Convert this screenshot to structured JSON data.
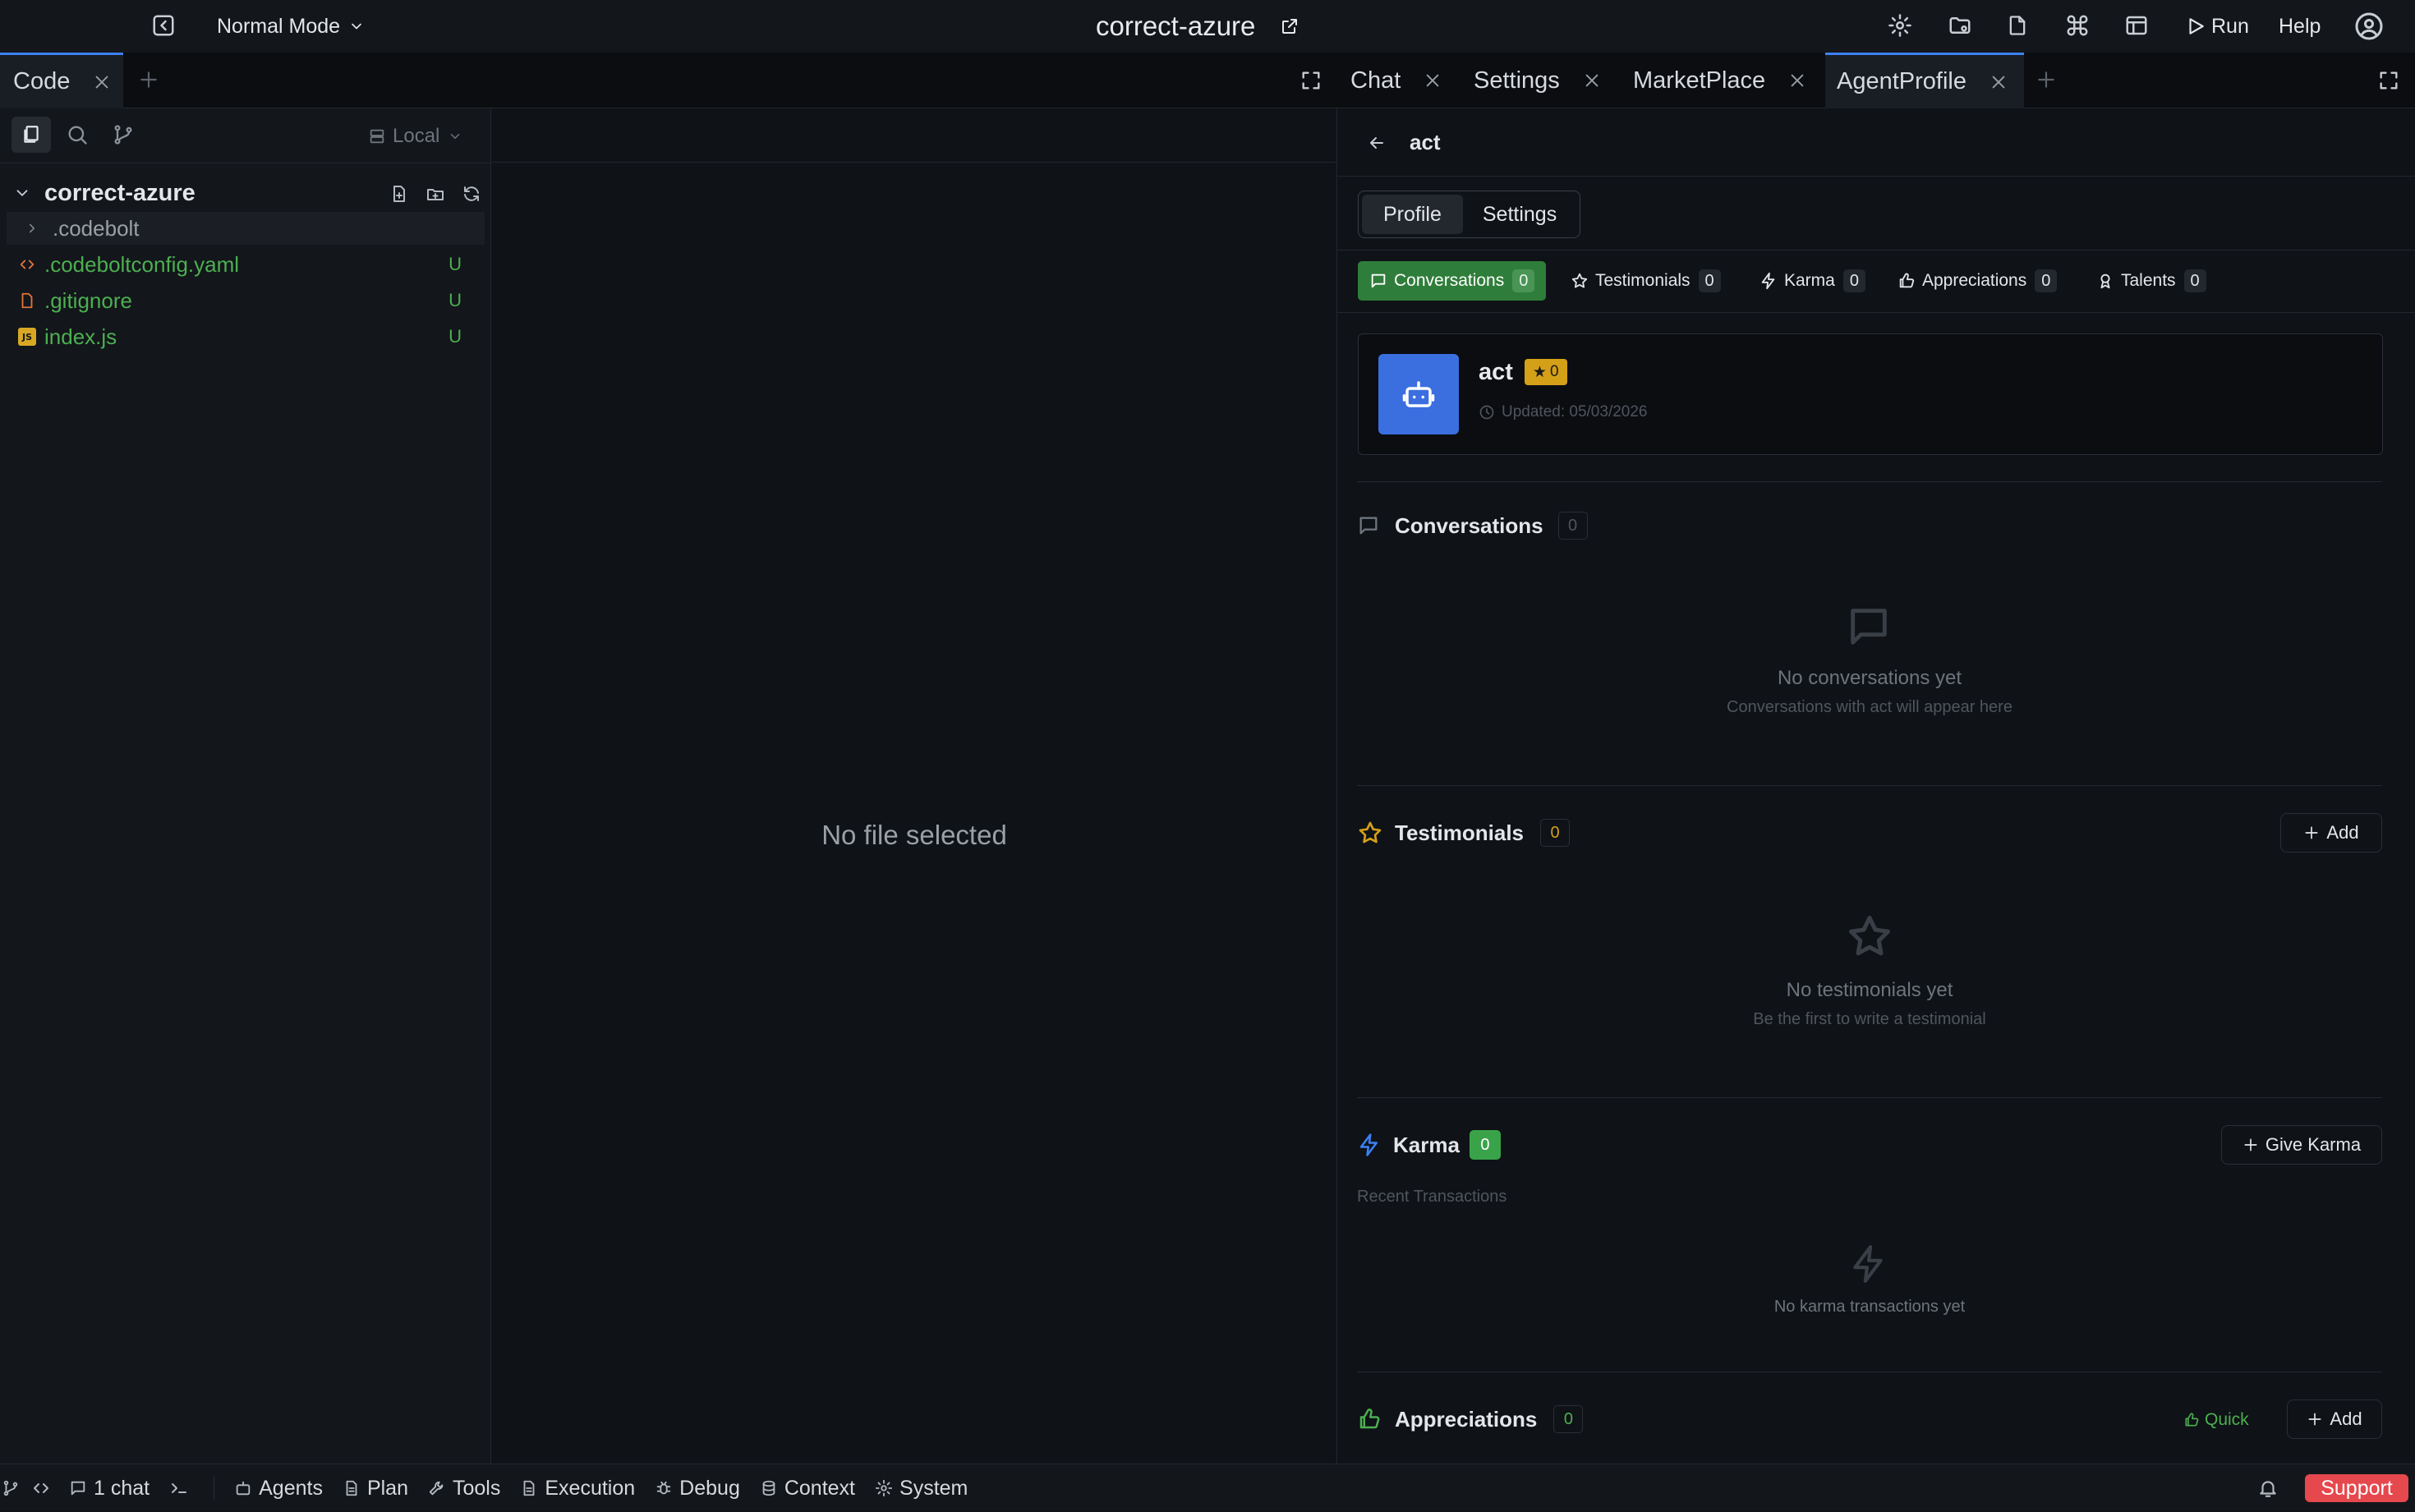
{
  "topbar": {
    "mode": "Normal Mode",
    "project": "correct-azure",
    "run": "Run",
    "help": "Help"
  },
  "tabs_left": [
    {
      "label": "Code"
    }
  ],
  "tabs_right": [
    {
      "label": "Chat"
    },
    {
      "label": "Settings"
    },
    {
      "label": "MarketPlace"
    },
    {
      "label": "AgentProfile"
    }
  ],
  "explorer": {
    "location": "Local",
    "root": "correct-azure",
    "files": [
      {
        "name": ".codebolt",
        "status": ""
      },
      {
        "name": ".codeboltconfig.yaml",
        "status": "U"
      },
      {
        "name": ".gitignore",
        "status": "U"
      },
      {
        "name": "index.js",
        "status": "U"
      }
    ]
  },
  "editor": {
    "empty": "No file selected"
  },
  "profile": {
    "back_title": "act",
    "subtabs": [
      "Profile",
      "Settings"
    ],
    "filters": [
      {
        "label": "Conversations",
        "count": "0"
      },
      {
        "label": "Testimonials",
        "count": "0"
      },
      {
        "label": "Karma",
        "count": "0"
      },
      {
        "label": "Appreciations",
        "count": "0"
      },
      {
        "label": "Talents",
        "count": "0"
      }
    ],
    "agent": {
      "name": "act",
      "stars": "0",
      "updated": "Updated: 05/03/2026"
    },
    "conversations": {
      "title": "Conversations",
      "count": "0",
      "empty": "No conversations yet",
      "empty_sub": "Conversations with act will appear here"
    },
    "testimonials": {
      "title": "Testimonials",
      "count": "0",
      "add": "Add",
      "empty": "No testimonials yet",
      "empty_sub": "Be the first to write a testimonial"
    },
    "karma": {
      "title": "Karma",
      "count": "0",
      "give": "Give Karma",
      "recent": "Recent Transactions",
      "empty": "No karma transactions yet"
    },
    "appreciations": {
      "title": "Appreciations",
      "count": "0",
      "quick": "Quick",
      "add": "Add"
    }
  },
  "statusbar": {
    "chat": "1 chat",
    "items": [
      "Agents",
      "Plan",
      "Tools",
      "Execution",
      "Debug",
      "Context",
      "System"
    ],
    "support": "Support"
  },
  "colors": {
    "accent": "#3b82f6",
    "green": "#2f7d3a",
    "badge": "#d4a017",
    "support": "#e5484d"
  }
}
